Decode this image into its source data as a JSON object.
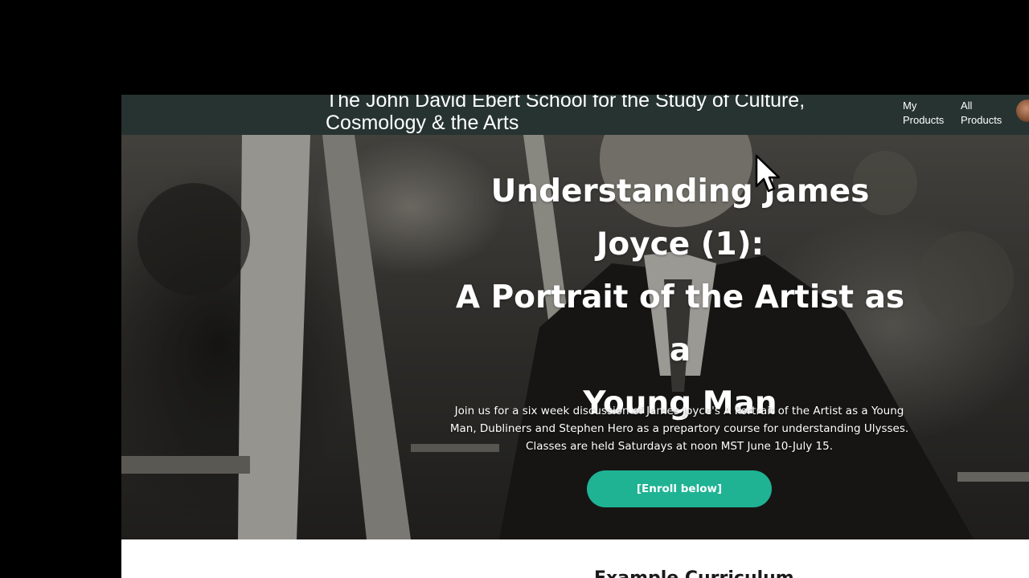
{
  "header": {
    "title_line1": "The John David Ebert School for the Study of Culture,",
    "title_line2": "Cosmology & the Arts",
    "nav": {
      "my_products_line1": "My",
      "my_products_line2": "Products",
      "all_products_line1": "All",
      "all_products_line2": "Products"
    }
  },
  "hero": {
    "title_lines": [
      "Understanding James",
      "Joyce (1):",
      "A Portrait of the Artist as a",
      "Young Man"
    ],
    "description": "Join us for a six week discussion of James Joyce's A Portrait of the Artist as a Young Man, Dubliners and Stephen Hero as a prepartory course for understanding Ulysses. Classes are held Saturdays at noon MST June 10-July 15.",
    "button_label": "[Enroll below]"
  },
  "section": {
    "heading_partial": "Example Curriculum"
  },
  "colors": {
    "topbar": "#263331",
    "accent": "#1fb394",
    "backdrop": "#000000"
  },
  "icons": {
    "cursor": "mouse-pointer-icon",
    "avatar": "user-avatar"
  }
}
